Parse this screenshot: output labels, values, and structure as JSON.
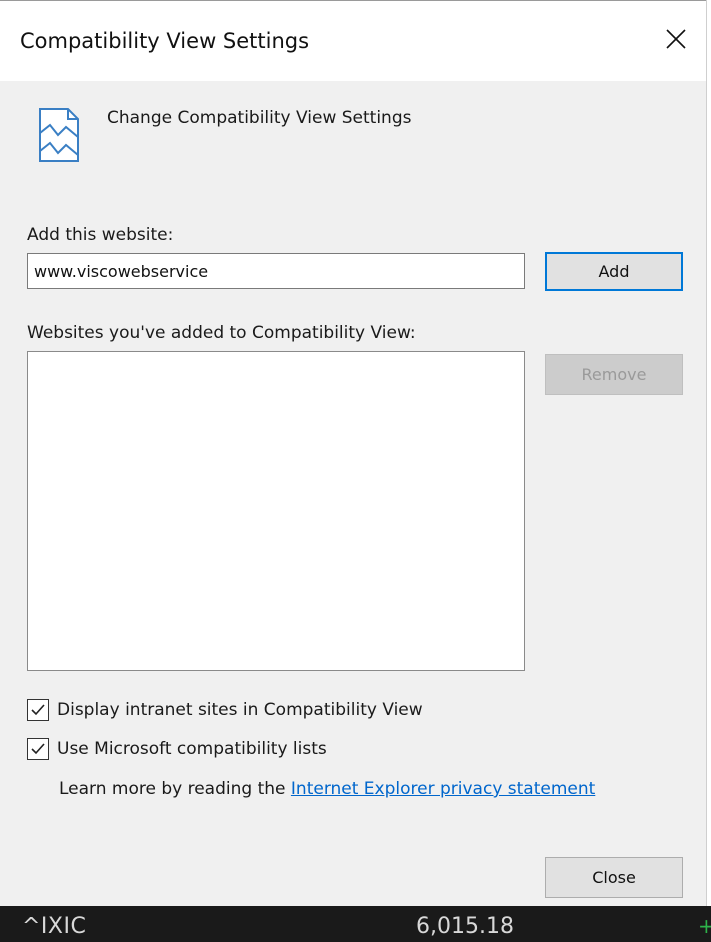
{
  "window": {
    "title": "Compatibility View Settings",
    "close_glyph": "close-icon"
  },
  "header": {
    "icon": "compatibility-view-icon",
    "text": "Change Compatibility View Settings"
  },
  "add_section": {
    "label": "Add this website:",
    "input_value": "www.viscowebservice",
    "add_button": "Add"
  },
  "list_section": {
    "label": "Websites you've added to Compatibility View:",
    "items": [],
    "remove_button": "Remove"
  },
  "options": {
    "intranet": {
      "label": "Display intranet sites in Compatibility View",
      "checked": true
    },
    "ms_lists": {
      "label": "Use Microsoft compatibility lists",
      "checked": true
    }
  },
  "learn_more": {
    "prefix": "Learn more by reading the",
    "link_text": "Internet Explorer privacy statement"
  },
  "footer": {
    "close_button": "Close"
  },
  "background": {
    "ticker": "^IXIC",
    "value": "6,015.18",
    "change_sign": "+"
  },
  "colors": {
    "accent": "#0078d7",
    "link": "#0066cc",
    "dialog_bg": "#f0f0f0",
    "positive": "#2db34a"
  }
}
